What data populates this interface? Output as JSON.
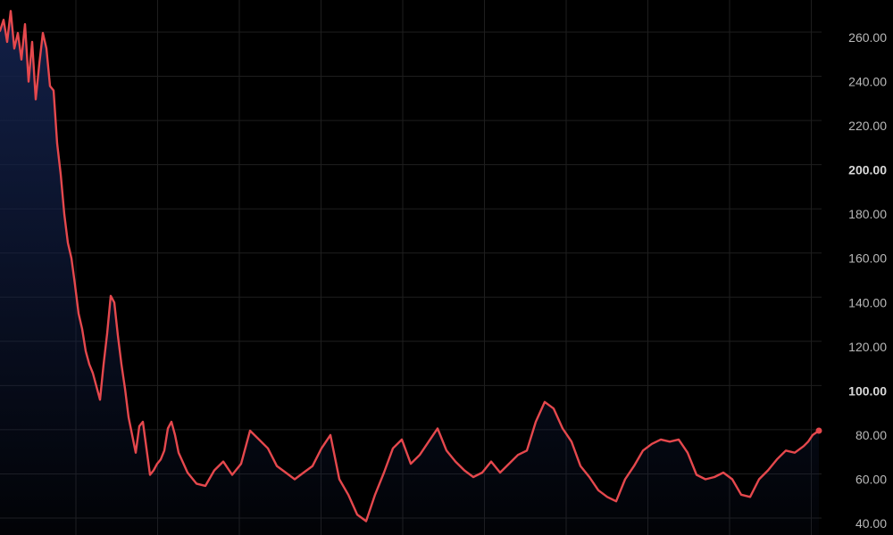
{
  "chart_data": {
    "type": "area",
    "title": "",
    "xlabel": "",
    "ylabel": "",
    "ylim": [
      36,
      273
    ],
    "grid": true,
    "legend": "none",
    "y_ticks": [
      "40.00",
      "60.00",
      "80.00",
      "100.00",
      "120.00",
      "140.00",
      "160.00",
      "180.00",
      "200.00",
      "220.00",
      "240.00",
      "260.00"
    ],
    "y_tick_values": [
      40,
      60,
      80,
      100,
      120,
      140,
      160,
      180,
      200,
      220,
      240,
      260
    ],
    "y_ticks_bold": [
      "100.00",
      "200.00"
    ],
    "x_grid_count": 10,
    "x_range": [
      0,
      1000
    ],
    "series": [
      {
        "line_color": "#e5484d",
        "fill_color": "#13214a",
        "x": [
          0,
          4,
          8,
          12,
          16,
          20,
          24,
          28,
          32,
          36,
          40,
          44,
          48,
          52,
          56,
          60,
          64,
          68,
          72,
          76,
          80,
          84,
          88,
          92,
          96,
          100,
          104,
          108,
          112,
          116,
          120,
          124,
          128,
          132,
          136,
          140,
          144,
          148,
          152,
          156,
          160,
          164,
          168,
          172,
          176,
          180,
          184,
          188,
          192,
          196,
          200,
          210,
          220,
          230,
          240,
          250,
          260,
          270,
          280,
          290,
          300,
          310,
          320,
          330,
          340,
          350,
          360,
          370,
          380,
          390,
          400,
          410,
          420,
          430,
          440,
          450,
          460,
          470,
          480,
          490,
          500,
          510,
          520,
          530,
          540,
          550,
          560,
          570,
          580,
          590,
          600,
          610,
          620,
          630,
          640,
          650,
          660,
          670,
          680,
          690,
          700,
          710,
          720,
          730,
          740,
          750,
          760,
          770,
          780,
          790,
          800,
          810,
          820,
          830,
          840,
          850,
          860,
          870,
          880,
          890,
          900,
          905,
          910,
          917
        ],
        "values": [
          263,
          268,
          258,
          272,
          255,
          262,
          250,
          266,
          240,
          258,
          232,
          248,
          262,
          255,
          238,
          236,
          212,
          198,
          180,
          167,
          160,
          148,
          135,
          128,
          118,
          112,
          108,
          102,
          96,
          112,
          126,
          143,
          140,
          125,
          112,
          101,
          88,
          80,
          72,
          84,
          86,
          74,
          62,
          64,
          67,
          69,
          73,
          83,
          86,
          80,
          72,
          63,
          58,
          57,
          64,
          68,
          62,
          67,
          82,
          78,
          74,
          66,
          63,
          60,
          63,
          66,
          74,
          80,
          60,
          53,
          44,
          41,
          53,
          63,
          74,
          78,
          67,
          71,
          77,
          83,
          73,
          68,
          64,
          61,
          63,
          68,
          63,
          67,
          71,
          73,
          86,
          95,
          92,
          83,
          77,
          66,
          61,
          55,
          52,
          50,
          60,
          66,
          73,
          76,
          78,
          77,
          78,
          72,
          62,
          60,
          61,
          63,
          60,
          53,
          52,
          60,
          64,
          69,
          73,
          72,
          75,
          77,
          80,
          82
        ]
      }
    ]
  }
}
